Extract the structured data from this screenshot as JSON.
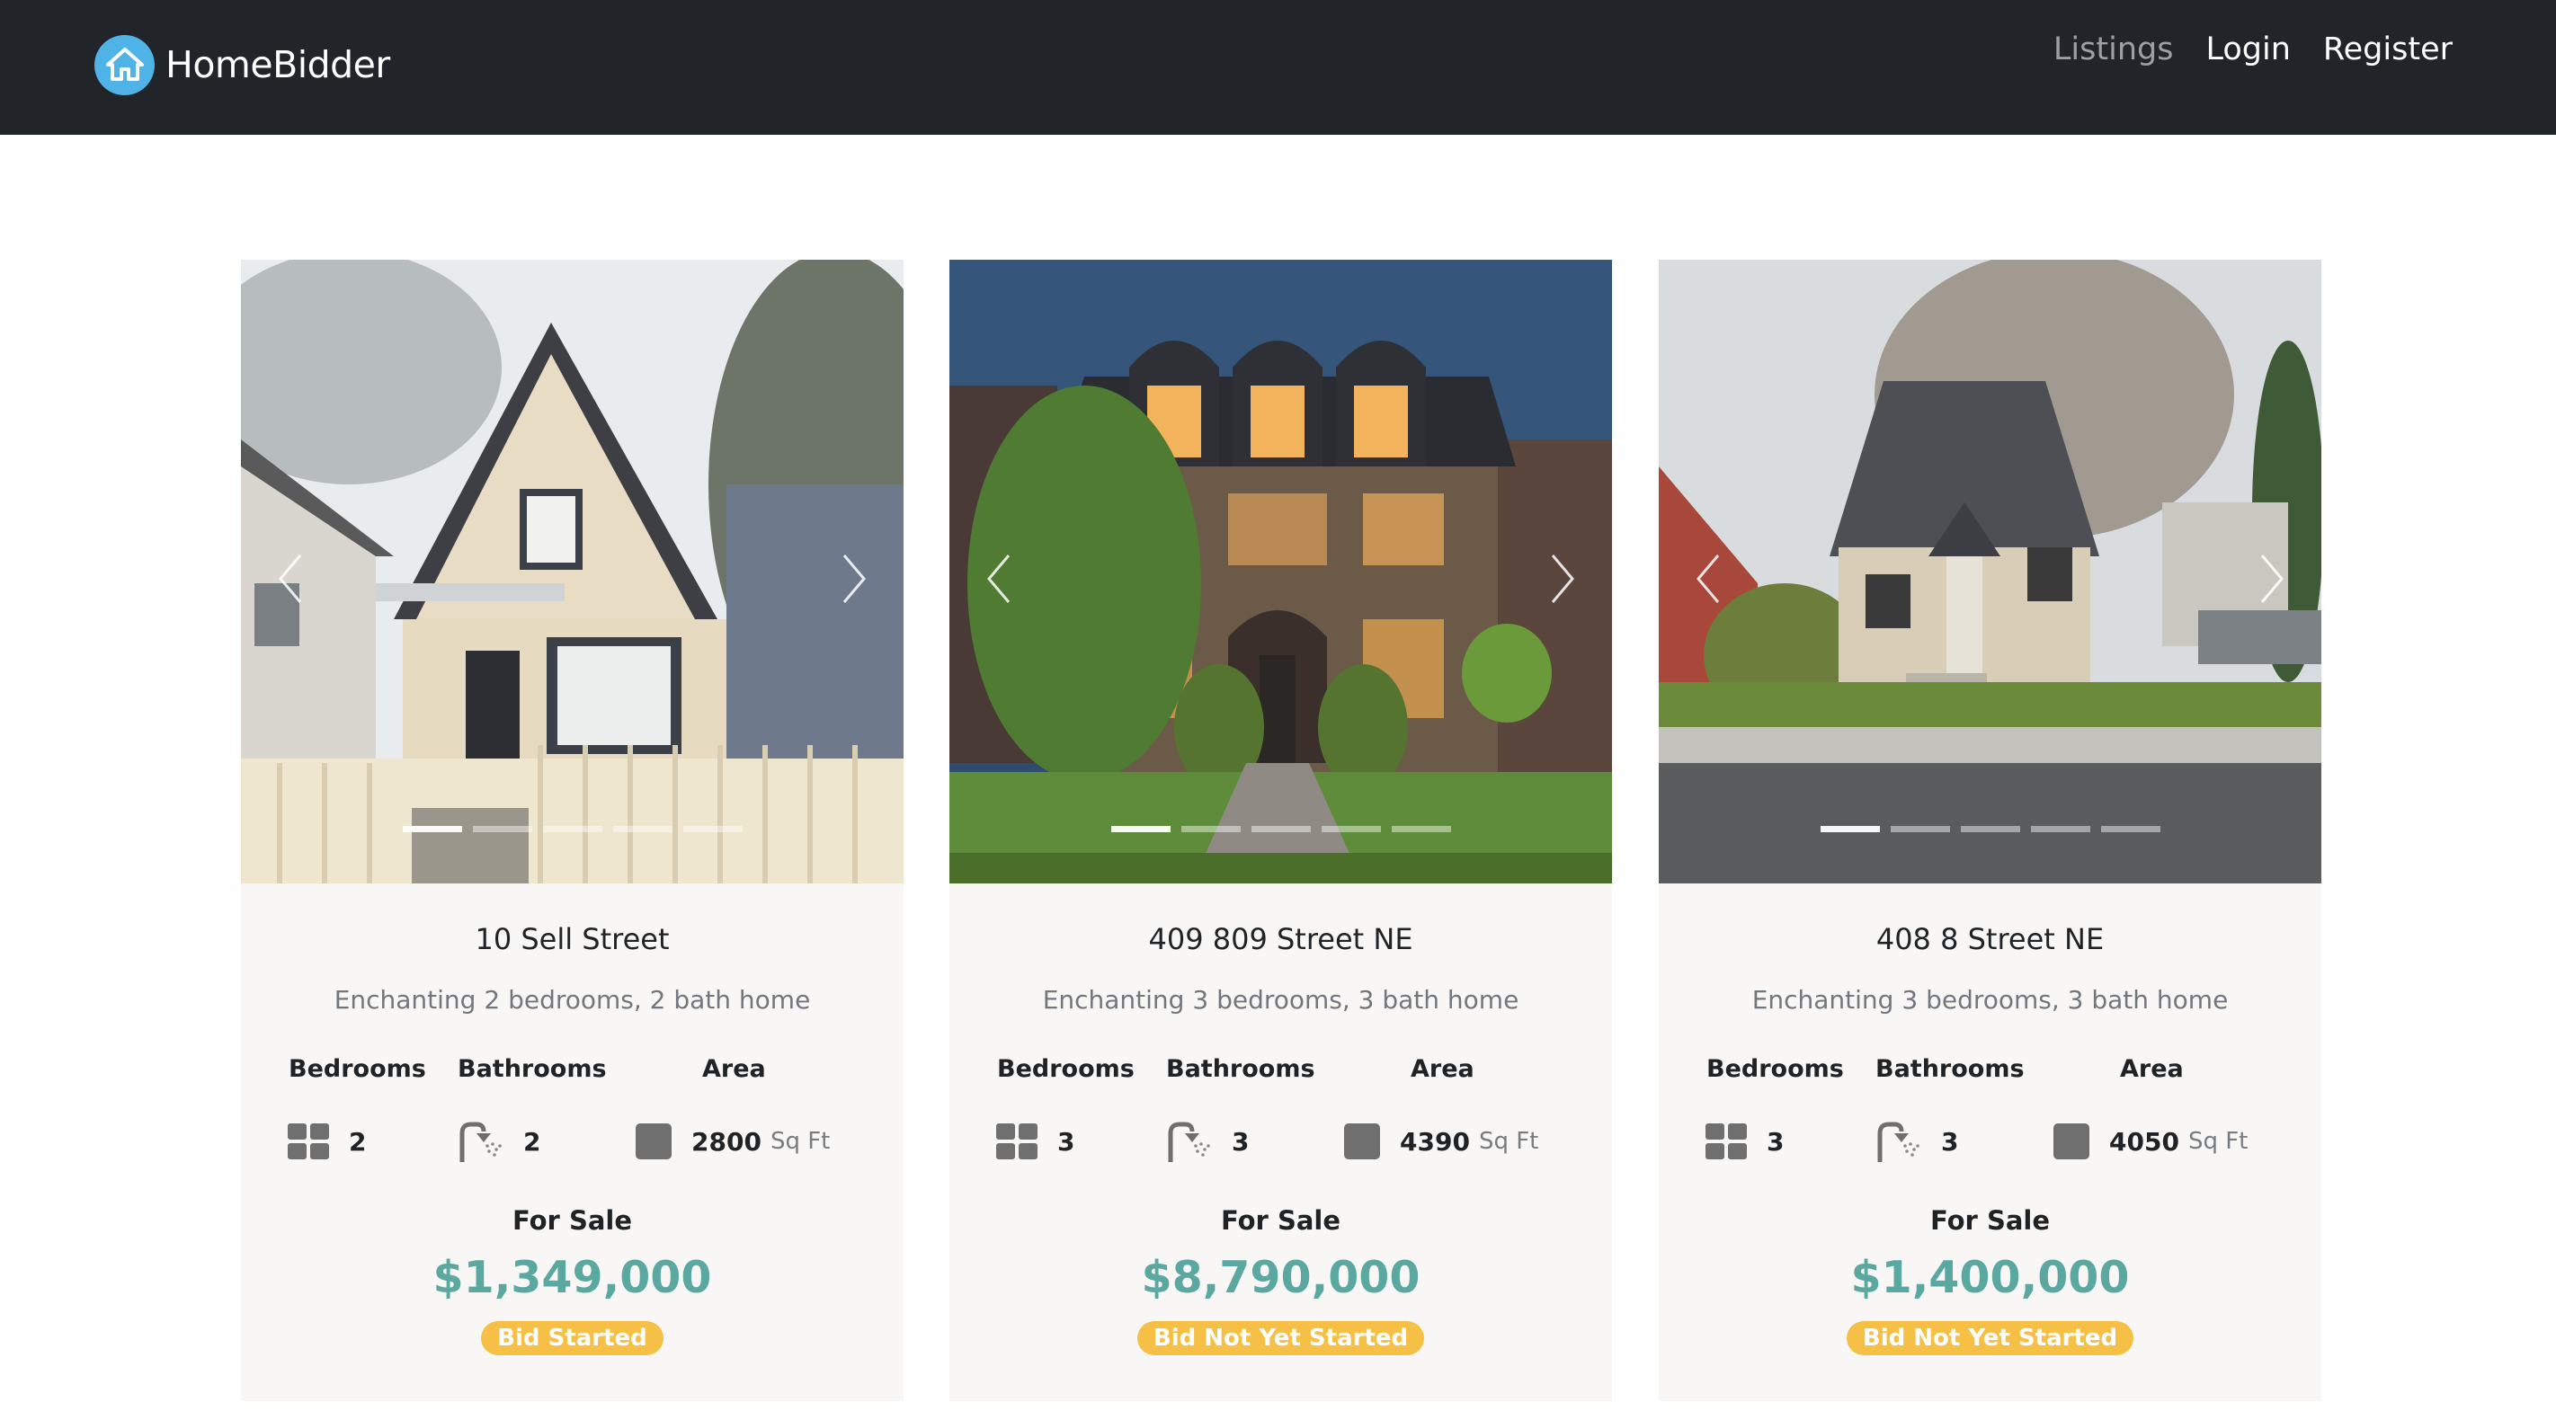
{
  "brand": {
    "name": "HomeBidder",
    "logo_icon": "house-icon",
    "logo_color": "#4fb3e8"
  },
  "nav": {
    "links": [
      "Listings",
      "Login",
      "Register"
    ]
  },
  "colors": {
    "navbar": "#212529",
    "price": "#5aa89f",
    "badge": "#f5c045"
  },
  "spec_labels": {
    "bedrooms": "Bedrooms",
    "bathrooms": "Bathrooms",
    "area": "Area",
    "area_unit": "Sq Ft"
  },
  "listings": [
    {
      "address": "10 Sell Street",
      "description": "Enchanting 2 bedrooms, 2 bath home",
      "bedrooms": "2",
      "bathrooms": "2",
      "area": "2800",
      "status": "For Sale",
      "price": "$1,349,000",
      "bid_status": "Bid Started",
      "photo_count": 5,
      "active_photo": 1
    },
    {
      "address": "409 809 Street NE",
      "description": "Enchanting 3 bedrooms, 3 bath home",
      "bedrooms": "3",
      "bathrooms": "3",
      "area": "4390",
      "status": "For Sale",
      "price": "$8,790,000",
      "bid_status": "Bid Not Yet Started",
      "photo_count": 5,
      "active_photo": 1
    },
    {
      "address": "408 8 Street NE",
      "description": "Enchanting 3 bedrooms, 3 bath home",
      "bedrooms": "3",
      "bathrooms": "3",
      "area": "4050",
      "status": "For Sale",
      "price": "$1,400,000",
      "bid_status": "Bid Not Yet Started",
      "photo_count": 5,
      "active_photo": 1
    }
  ]
}
